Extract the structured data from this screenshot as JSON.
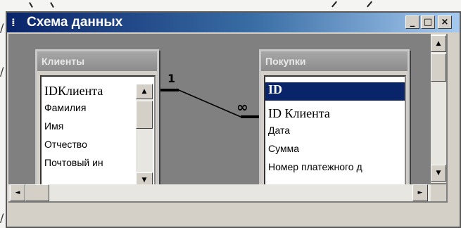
{
  "window": {
    "title": "Схема данных",
    "controls": {
      "minimize": "_",
      "maximize": "□",
      "close": "×"
    }
  },
  "tables": [
    {
      "title": "Клиенты",
      "fields": [
        "IDКлиента",
        "Фамилия",
        "Имя",
        "Отчество",
        "Почтовый ин"
      ]
    },
    {
      "title": "Покупки",
      "fields": [
        "ID",
        "ID Клиента",
        "Дата",
        "Сумма",
        "Номер платежного д"
      ],
      "selected_field": "ID"
    }
  ],
  "relationship": {
    "one_label": "1",
    "many_label": "∞"
  },
  "scrollbars": {
    "up": "▲",
    "down": "▼",
    "left": "◄",
    "right": "►"
  }
}
